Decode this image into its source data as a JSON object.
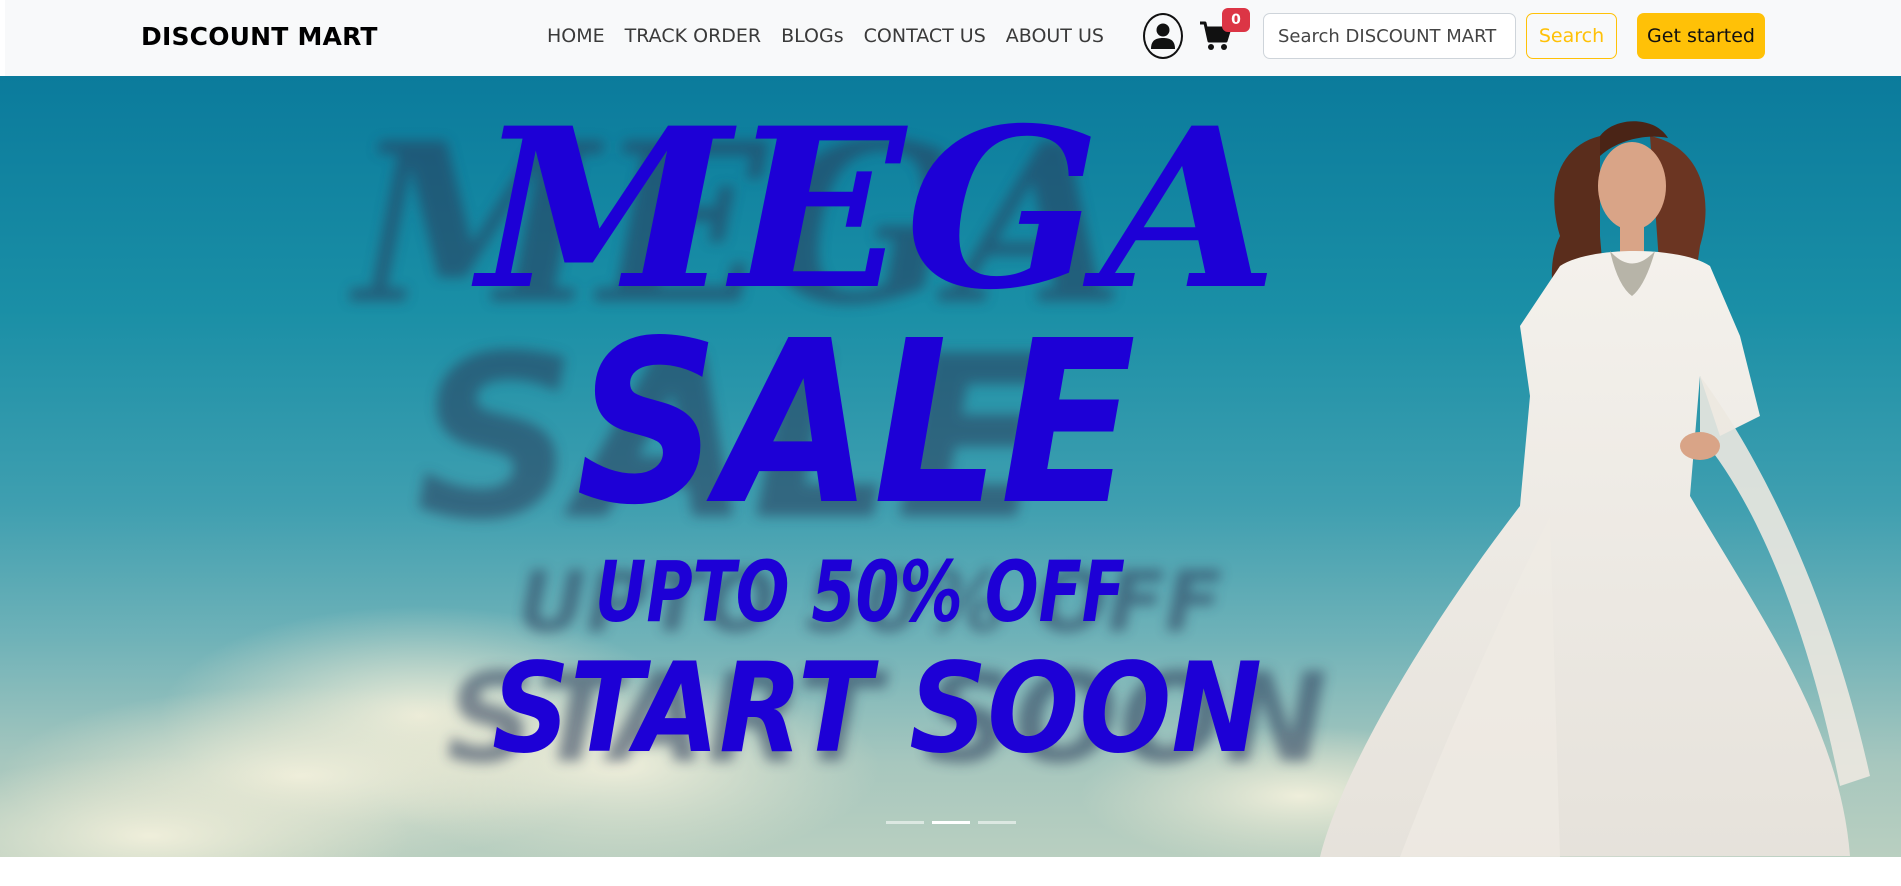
{
  "header": {
    "brand": "DISCOUNT MART",
    "nav": [
      {
        "label": "HOME"
      },
      {
        "label": "TRACK ORDER"
      },
      {
        "label": "BLOGs"
      },
      {
        "label": "CONTACT US"
      },
      {
        "label": "ABOUT US"
      }
    ],
    "cart_count": "0",
    "search": {
      "placeholder": "Search DISCOUNT MART",
      "button_label": "Search"
    },
    "cta_label": "Get started",
    "icons": [
      "user-circle-icon",
      "shopping-cart-icon"
    ]
  },
  "hero": {
    "headline_1": "MEGA",
    "headline_2": "SALE",
    "offer": "UPTO 50% OFF",
    "tagline": "START SOON",
    "active_slide": 2,
    "slide_count": 3
  },
  "colors": {
    "accent": "#ffc107",
    "badge": "#dc3545",
    "headline": "#1d00d6",
    "navbar_bg": "#f8f9fa"
  }
}
